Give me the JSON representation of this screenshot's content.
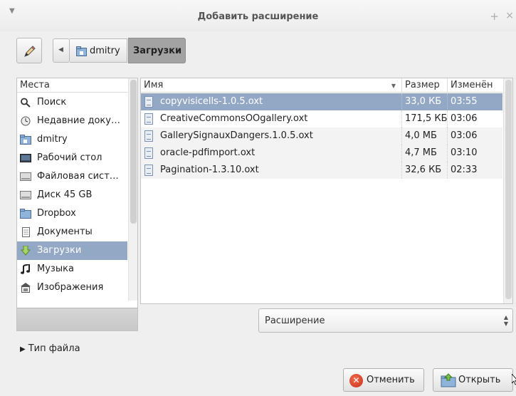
{
  "window": {
    "title": "Добавить расширение",
    "close_glyph": "×",
    "plus_glyph": "+"
  },
  "pathbar": {
    "crumbs": [
      "dmitry",
      "Загрузки"
    ]
  },
  "places": {
    "header": "Места",
    "items": [
      {
        "label": "Поиск",
        "icon": "search-icon"
      },
      {
        "label": "Недавние доку…",
        "icon": "recent-icon"
      },
      {
        "label": "dmitry",
        "icon": "home-folder-icon"
      },
      {
        "label": "Рабочий стол",
        "icon": "desktop-icon"
      },
      {
        "label": "Файловая сист…",
        "icon": "filesystem-icon"
      },
      {
        "label": "Диск 45 GB",
        "icon": "disk-icon"
      },
      {
        "label": "Dropbox",
        "icon": "folder-icon"
      },
      {
        "label": "Документы",
        "icon": "documents-icon"
      },
      {
        "label": "Загрузки",
        "icon": "downloads-icon"
      },
      {
        "label": "Музыка",
        "icon": "music-icon"
      },
      {
        "label": "Изображения",
        "icon": "pictures-icon"
      }
    ],
    "selected_index": 8
  },
  "files": {
    "columns": {
      "name": "Имя",
      "size": "Размер",
      "modified": "Изменён"
    },
    "rows": [
      {
        "name": "copyvisicells-1.0.5.oxt",
        "size": "33,0 КБ",
        "modified": "03:55"
      },
      {
        "name": "CreativeCommonsOOgallery.oxt",
        "size": "171,5 КБ",
        "modified": "03:06"
      },
      {
        "name": "GallerySignauxDangers.1.0.5.oxt",
        "size": "4,0 МБ",
        "modified": "03:06"
      },
      {
        "name": "oracle-pdfimport.oxt",
        "size": "4,7 МБ",
        "modified": "03:10"
      },
      {
        "name": "Pagination-1.3.10.oxt",
        "size": "32,6 КБ",
        "modified": "02:33"
      }
    ],
    "selected_index": 0
  },
  "filter": {
    "value": "Расширение"
  },
  "filetype": {
    "label": "Тип файла"
  },
  "buttons": {
    "cancel": "Отменить",
    "open": "Открыть"
  },
  "colors": {
    "selection": "#93a8c5",
    "active_crumb": "#a3a3a3"
  }
}
